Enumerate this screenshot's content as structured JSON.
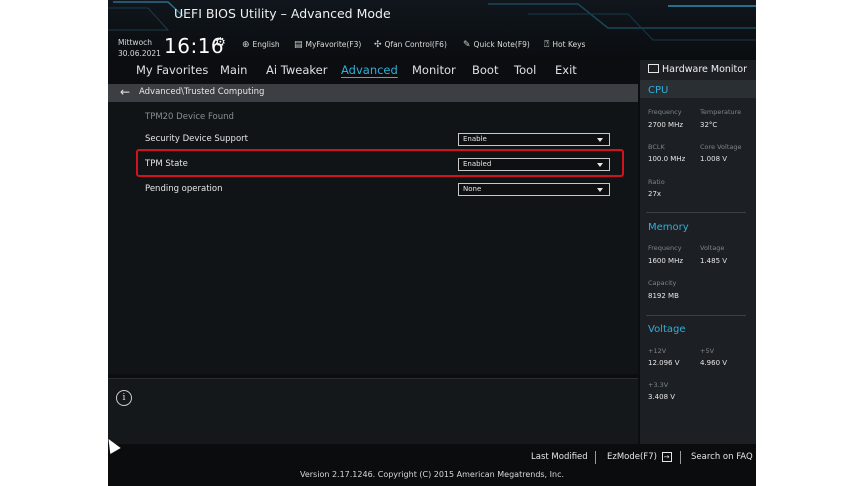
{
  "window": {
    "title": "UEFI BIOS Utility – Advanced Mode"
  },
  "clock": {
    "day": "Mittwoch",
    "date": "30.06.2021",
    "time": "16:16"
  },
  "toolbar": {
    "language": "English",
    "myfavorite": "MyFavorite(F3)",
    "qfan": "Qfan Control(F6)",
    "quicknote": "Quick Note(F9)",
    "hotkeys": "Hot Keys"
  },
  "nav": [
    "My Favorites",
    "Main",
    "Ai Tweaker",
    "Advanced",
    "Monitor",
    "Boot",
    "Tool",
    "Exit"
  ],
  "active_tab": "Advanced",
  "breadcrumb": "Advanced\\Trusted Computing",
  "settings": {
    "status": "TPM20 Device Found",
    "rows": [
      {
        "label": "Security Device Support",
        "value": "Enable"
      },
      {
        "label": "TPM State",
        "value": "Enabled"
      },
      {
        "label": "Pending operation",
        "value": "None"
      }
    ]
  },
  "hw": {
    "title": "Hardware Monitor",
    "cpu": {
      "heading": "CPU",
      "freq_label": "Frequency",
      "freq": "2700 MHz",
      "temp_label": "Temperature",
      "temp": "32°C",
      "bclk_label": "BCLK",
      "bclk": "100.0 MHz",
      "vcore_label": "Core Voltage",
      "vcore": "1.008 V",
      "ratio_label": "Ratio",
      "ratio": "27x"
    },
    "memory": {
      "heading": "Memory",
      "freq_label": "Frequency",
      "freq": "1600 MHz",
      "volt_label": "Voltage",
      "volt": "1.485 V",
      "cap_label": "Capacity",
      "cap": "8192 MB"
    },
    "voltage": {
      "heading": "Voltage",
      "v12_label": "+12V",
      "v12": "12.096 V",
      "v5_label": "+5V",
      "v5": "4.960 V",
      "v33_label": "+3.3V",
      "v33": "3.408 V"
    }
  },
  "footer": {
    "last_modified": "Last Modified",
    "ezmode": "EzMode(F7)",
    "search": "Search on FAQ",
    "copyright": "Version 2.17.1246. Copyright (C) 2015 American Megatrends, Inc."
  },
  "colors": {
    "accent": "#2eb0d8",
    "highlight": "#d0141c",
    "background": "#0b0d10",
    "panel": "#1c2024"
  }
}
